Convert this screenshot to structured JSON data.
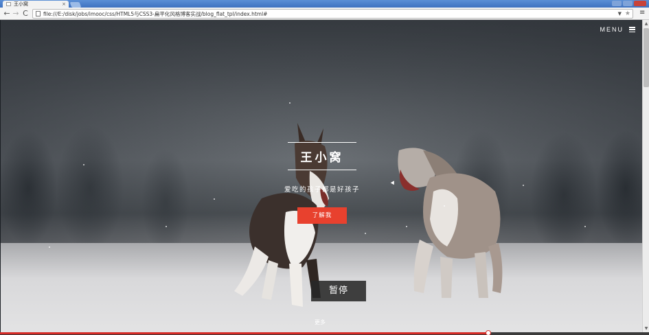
{
  "browser": {
    "tab_title": "王小窝",
    "tab_close": "×",
    "url": "file:///E:/disk/jobs/imooc/css/HTML5与CSS3-扁平化风格博客实战/blog_flat_tpl/index.html#",
    "back_icon": "←",
    "forward_icon": "→",
    "reload_icon": "C",
    "menu_icon": "≡"
  },
  "page": {
    "menu_label": "MENU",
    "title": "王小窝",
    "subtitle": "爱吃的孩子都是好孩子",
    "cta_label": "了解我",
    "pause_label": "暂停",
    "more_label": "更多"
  },
  "video_progress": {
    "fraction": 0.752
  },
  "colors": {
    "accent": "#e8412e",
    "progress": "#d62b26"
  }
}
